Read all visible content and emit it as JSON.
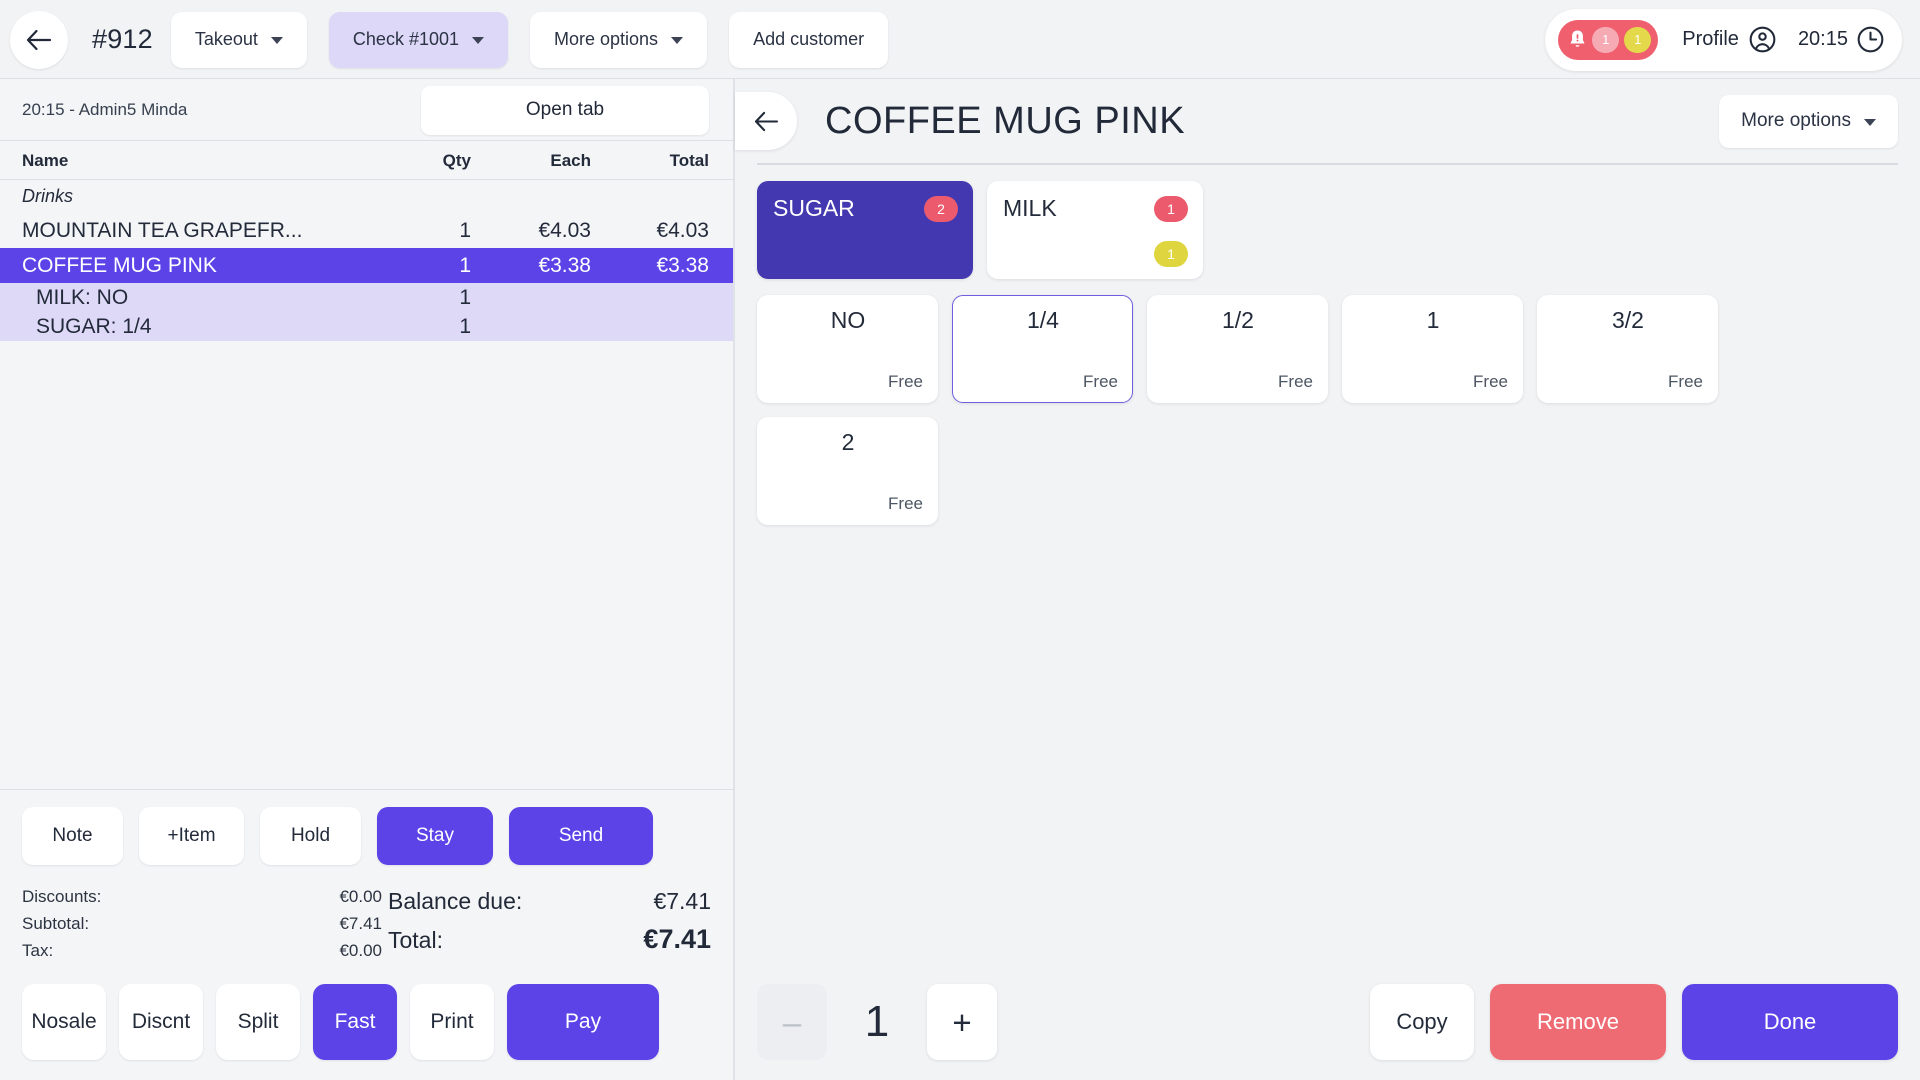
{
  "topbar": {
    "back_icon": "arrow-left-icon",
    "order_number": "#912",
    "order_type": "Takeout",
    "check": "Check #1001",
    "more_options": "More options",
    "add_customer": "Add customer",
    "notification": {
      "bell_icon": "bell-alert-icon",
      "badge_pink": "1",
      "badge_yellow": "1"
    },
    "profile_label": "Profile",
    "profile_icon": "user-circle-icon",
    "time": "20:15",
    "clock_icon": "clock-icon"
  },
  "left": {
    "ticket_meta": "20:15 - Admin5 Minda",
    "open_tab": "Open tab",
    "columns": {
      "name": "Name",
      "qty": "Qty",
      "each": "Each",
      "total": "Total"
    },
    "category": "Drinks",
    "rows": [
      {
        "name": "MOUNTAIN TEA GRAPEFR...",
        "qty": "1",
        "each": "€4.03",
        "total": "€4.03",
        "state": "normal"
      },
      {
        "name": "COFFEE MUG PINK",
        "qty": "1",
        "each": "€3.38",
        "total": "€3.38",
        "state": "selected"
      },
      {
        "name": "MILK: NO",
        "qty": "1",
        "each": "",
        "total": "",
        "state": "modifier"
      },
      {
        "name": "SUGAR: 1/4",
        "qty": "1",
        "each": "",
        "total": "",
        "state": "modifier"
      }
    ],
    "actions": [
      {
        "label": "Note",
        "style": "white"
      },
      {
        "label": "+Item",
        "style": "white"
      },
      {
        "label": "Hold",
        "style": "white"
      },
      {
        "label": "Stay",
        "style": "purple"
      },
      {
        "label": "Send",
        "style": "purple"
      }
    ],
    "totals": {
      "discounts_label": "Discounts:",
      "discounts_value": "€0.00",
      "subtotal_label": "Subtotal:",
      "subtotal_value": "€7.41",
      "tax_label": "Tax:",
      "tax_value": "€0.00",
      "balance_label": "Balance due:",
      "balance_value": "€7.41",
      "total_label": "Total:",
      "total_value": "€7.41"
    },
    "pay_buttons": [
      {
        "label": "Nosale",
        "style": "white"
      },
      {
        "label": "Discnt",
        "style": "white"
      },
      {
        "label": "Split",
        "style": "white"
      },
      {
        "label": "Fast",
        "style": "purple"
      },
      {
        "label": "Print",
        "style": "white"
      },
      {
        "label": "Pay",
        "style": "purple"
      }
    ]
  },
  "right": {
    "back_icon": "arrow-left-icon",
    "product_title": "COFFEE MUG PINK",
    "more_options": "More options",
    "groups": [
      {
        "name": "SUGAR",
        "badge_red": "2",
        "badge_yellow": "",
        "active": true
      },
      {
        "name": "MILK",
        "badge_red": "1",
        "badge_yellow": "1",
        "active": false
      }
    ],
    "options": [
      {
        "name": "NO",
        "price": "Free",
        "selected": false
      },
      {
        "name": "1/4",
        "price": "Free",
        "selected": true
      },
      {
        "name": "1/2",
        "price": "Free",
        "selected": false
      },
      {
        "name": "1",
        "price": "Free",
        "selected": false
      },
      {
        "name": "3/2",
        "price": "Free",
        "selected": false
      },
      {
        "name": "2",
        "price": "Free",
        "selected": false
      }
    ],
    "quantity": {
      "decrement_icon": "minus-icon",
      "decrement_sign": "–",
      "value": "1",
      "increment_icon": "plus-icon",
      "increment_sign": "+"
    },
    "buttons": [
      {
        "label": "Copy",
        "style": "white"
      },
      {
        "label": "Remove",
        "style": "red"
      },
      {
        "label": "Done",
        "style": "purple"
      }
    ]
  },
  "colors": {
    "accent_purple": "#5b43e8",
    "group_active": "#4438b0",
    "row_selected": "#5b43e8",
    "row_modifier": "#ddd9f7",
    "check_chip": "#ddd8f8",
    "danger_red": "#ef6b73",
    "badge_red": "#ec5b6d",
    "badge_yellow": "#dfd63f",
    "notif_red": "#ef5f6e",
    "page_bg": "#f2f3f5"
  }
}
